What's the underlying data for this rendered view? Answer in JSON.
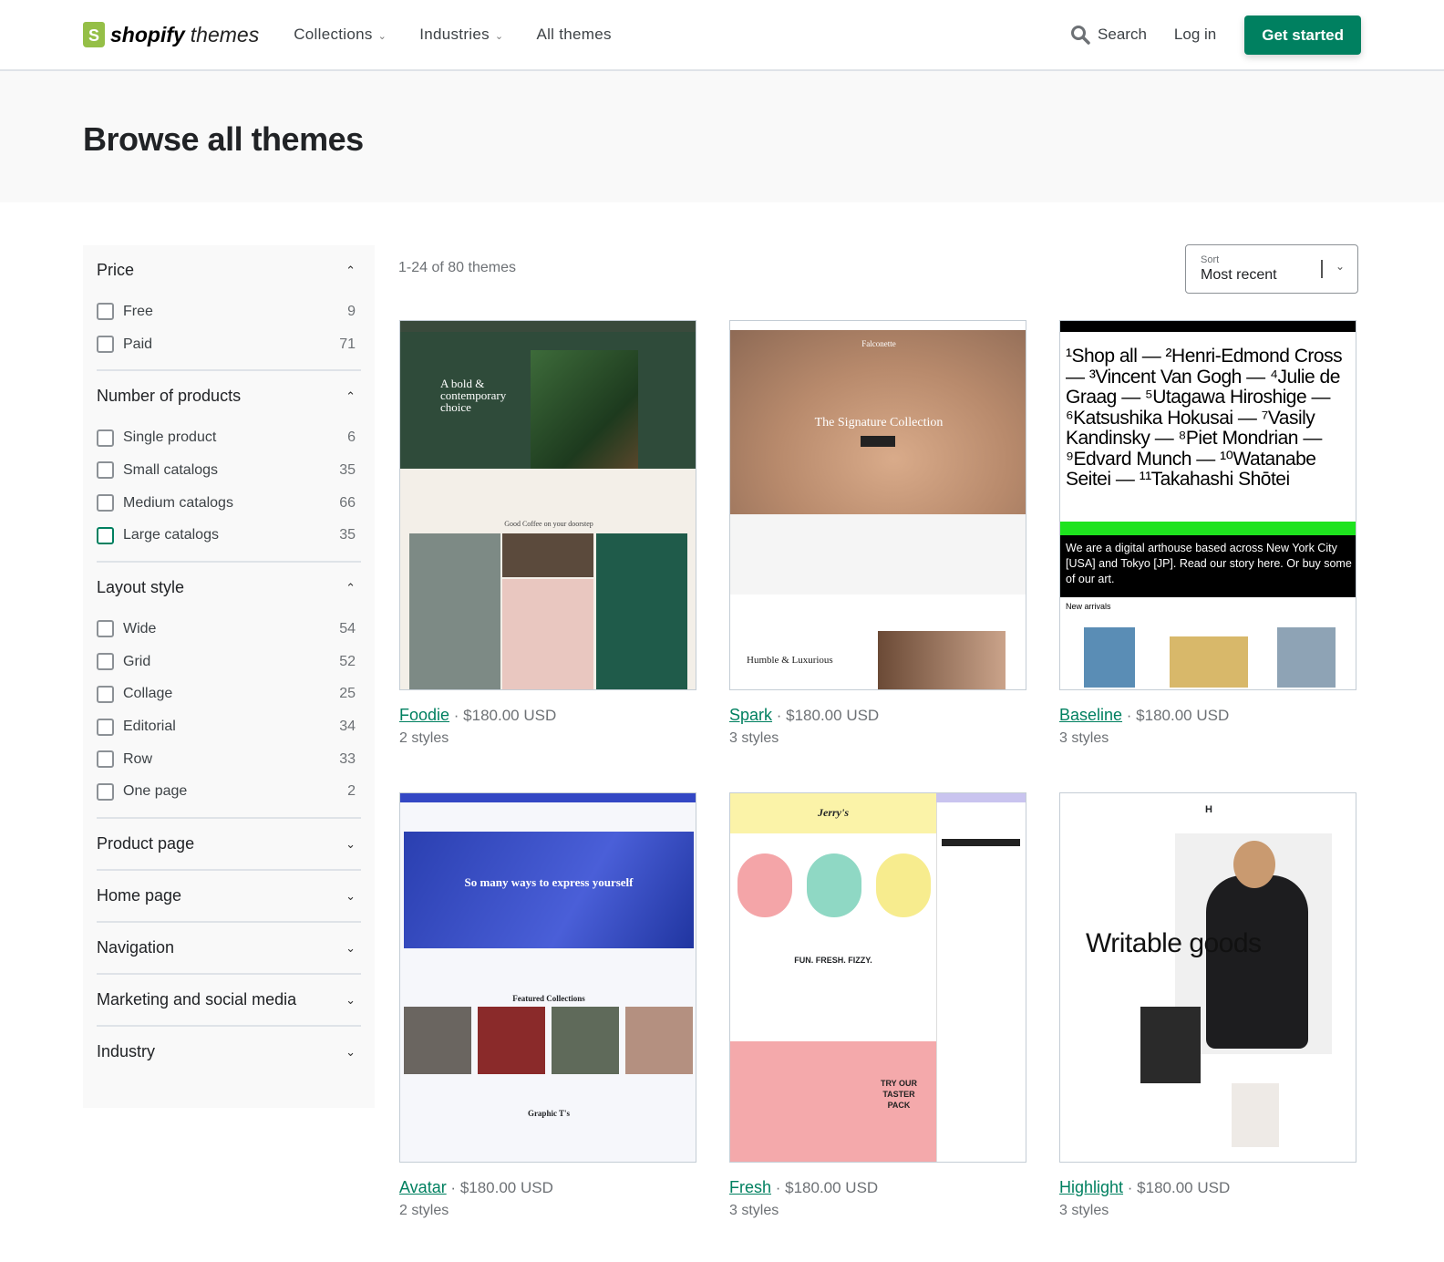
{
  "header": {
    "logo_bold": "shopify",
    "logo_light": "themes",
    "nav": [
      {
        "label": "Collections"
      },
      {
        "label": "Industries"
      },
      {
        "label": "All themes"
      }
    ],
    "search": "Search",
    "login": "Log in",
    "cta": "Get started"
  },
  "hero": {
    "title": "Browse all themes"
  },
  "sidebar": {
    "sections": [
      {
        "title": "Price",
        "open": true,
        "items": [
          {
            "label": "Free",
            "count": "9"
          },
          {
            "label": "Paid",
            "count": "71"
          }
        ]
      },
      {
        "title": "Number of products",
        "open": true,
        "items": [
          {
            "label": "Single product",
            "count": "6"
          },
          {
            "label": "Small catalogs",
            "count": "35"
          },
          {
            "label": "Medium catalogs",
            "count": "66"
          },
          {
            "label": "Large catalogs",
            "count": "35"
          }
        ]
      },
      {
        "title": "Layout style",
        "open": true,
        "items": [
          {
            "label": "Wide",
            "count": "54"
          },
          {
            "label": "Grid",
            "count": "52"
          },
          {
            "label": "Collage",
            "count": "25"
          },
          {
            "label": "Editorial",
            "count": "34"
          },
          {
            "label": "Row",
            "count": "33"
          },
          {
            "label": "One page",
            "count": "2"
          }
        ]
      },
      {
        "title": "Product page",
        "open": false
      },
      {
        "title": "Home page",
        "open": false
      },
      {
        "title": "Navigation",
        "open": false
      },
      {
        "title": "Marketing and social media",
        "open": false
      },
      {
        "title": "Industry",
        "open": false
      }
    ]
  },
  "results": {
    "count": "1-24 of 80 themes",
    "sort_label": "Sort",
    "sort_value": "Most recent"
  },
  "themes": [
    {
      "name": "Foodie",
      "price": "$180.00 USD",
      "styles": "2 styles",
      "preview_text": "A bold & contemporary choice",
      "preview_sub": "Good Coffee on your doorstep"
    },
    {
      "name": "Spark",
      "price": "$180.00 USD",
      "styles": "3 styles",
      "preview_text": "The Signature Collection",
      "preview_sub": "Humble & Luxurious",
      "preview_brand": "Falconette"
    },
    {
      "name": "Baseline",
      "price": "$180.00 USD",
      "styles": "3 styles",
      "preview_text": "¹Shop all — ²Henri-Edmond Cross — ³Vincent Van Gogh — ⁴Julie de Graag — ⁵Utagawa Hiroshige — ⁶Katsushika Hokusai — ⁷Vasily Kandinsky — ⁸Piet Mondrian — ⁹Edvard Munch — ¹⁰Watanabe Seitei — ¹¹Takahashi Shōtei",
      "preview_sub": "We are a digital arthouse based across New York City [USA] and Tokyo [JP]. Read our story here. Or buy some of our art.",
      "preview_sub2": "New arrivals"
    },
    {
      "name": "Avatar",
      "price": "$180.00 USD",
      "styles": "2 styles",
      "preview_text": "So many ways to express yourself",
      "preview_sub": "Featured Collections",
      "preview_sub2": "Graphic T's"
    },
    {
      "name": "Fresh",
      "price": "$180.00 USD",
      "styles": "3 styles",
      "preview_text": "FUN. FRESH. FIZZY.",
      "preview_sub": "TRY OUR TASTER PACK",
      "preview_brand": "Jerry's"
    },
    {
      "name": "Highlight",
      "price": "$180.00 USD",
      "styles": "3 styles",
      "preview_text": "Writable goods"
    }
  ],
  "colors": {
    "accent": "#008060",
    "logo": "#95bf47",
    "panel": "#f9f9f9"
  }
}
